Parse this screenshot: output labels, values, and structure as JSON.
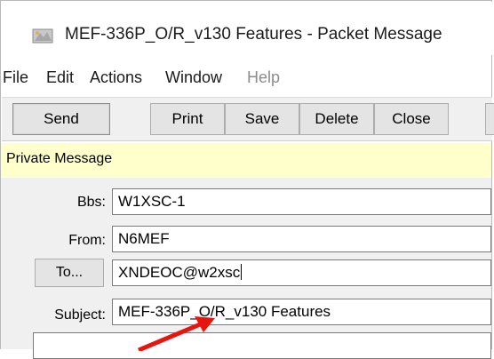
{
  "window": {
    "title": "MEF-336P_O/R_v130 Features - Packet Message"
  },
  "menu": {
    "items": [
      {
        "label": "File",
        "enabled": true
      },
      {
        "label": "Edit",
        "enabled": true
      },
      {
        "label": "Actions",
        "enabled": true
      },
      {
        "label": "Window",
        "enabled": true
      },
      {
        "label": "Help",
        "enabled": false
      }
    ]
  },
  "toolbar": {
    "send": "Send",
    "print": "Print",
    "save": "Save",
    "delete": "Delete",
    "close": "Close"
  },
  "banner": {
    "text": "Private Message",
    "color": "#ffffcc"
  },
  "form": {
    "bbs": {
      "label": "Bbs:",
      "value": "W1XSC-1"
    },
    "from": {
      "label": "From:",
      "value": "N6MEF"
    },
    "to": {
      "button": "To...",
      "value": "XNDEOC@w2xsc"
    },
    "subject": {
      "label": "Subject:",
      "value": "MEF-336P_O/R_v130 Features"
    }
  },
  "annotation": {
    "arrow_color": "#e8150f"
  }
}
